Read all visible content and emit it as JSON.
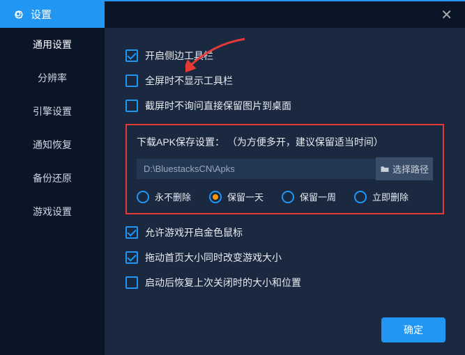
{
  "header": {
    "title": "设置"
  },
  "sidebar": {
    "items": [
      {
        "label": "通用设置"
      },
      {
        "label": "分辨率"
      },
      {
        "label": "引擎设置"
      },
      {
        "label": "通知恢复"
      },
      {
        "label": "备份还原"
      },
      {
        "label": "游戏设置"
      }
    ]
  },
  "options": {
    "opt1": "开启侧边工具栏",
    "opt2": "全屏时不显示工具栏",
    "opt3": "截屏时不询问直接保留图片到桌面",
    "opt4": "允许游戏开启金色鼠标",
    "opt5": "拖动首页大小同时改变游戏大小",
    "opt6": "启动后恢复上次关闭时的大小和位置"
  },
  "apk": {
    "title": "下载APK保存设置：  （为方便多开，建议保留适当时间）",
    "path": "D:\\BluestacksCN\\Apks",
    "browse": "选择路径",
    "r1": "永不删除",
    "r2": "保留一天",
    "r3": "保留一周",
    "r4": "立即删除"
  },
  "footer": {
    "ok": "确定"
  }
}
